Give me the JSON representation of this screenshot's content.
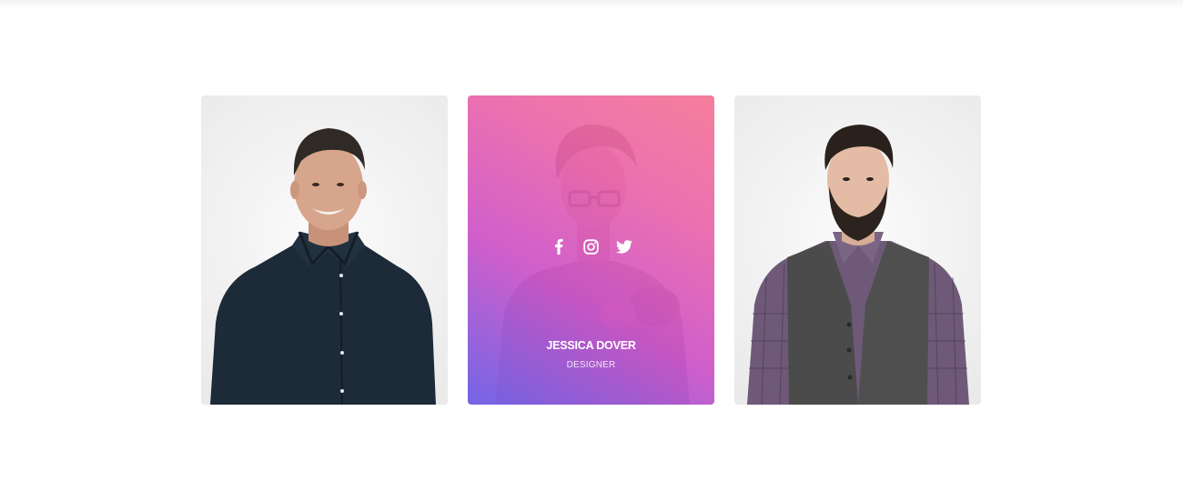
{
  "team": {
    "members": [
      {
        "name": "",
        "role": "",
        "photo": "man-in-dark-shirt-photo"
      },
      {
        "name": "JESSICA DOVER",
        "role": "DESIGNER",
        "photo": "woman-with-glasses-photo",
        "socials": [
          {
            "icon": "facebook-icon"
          },
          {
            "icon": "instagram-icon"
          },
          {
            "icon": "twitter-icon"
          }
        ]
      },
      {
        "name": "",
        "role": "",
        "photo": "man-in-vest-photo"
      }
    ]
  },
  "colors": {
    "overlay_gradient": [
      "#6e60e6",
      "#cd50c8",
      "#ec64aa",
      "#f67696"
    ],
    "card_background": "#eeeeee"
  }
}
